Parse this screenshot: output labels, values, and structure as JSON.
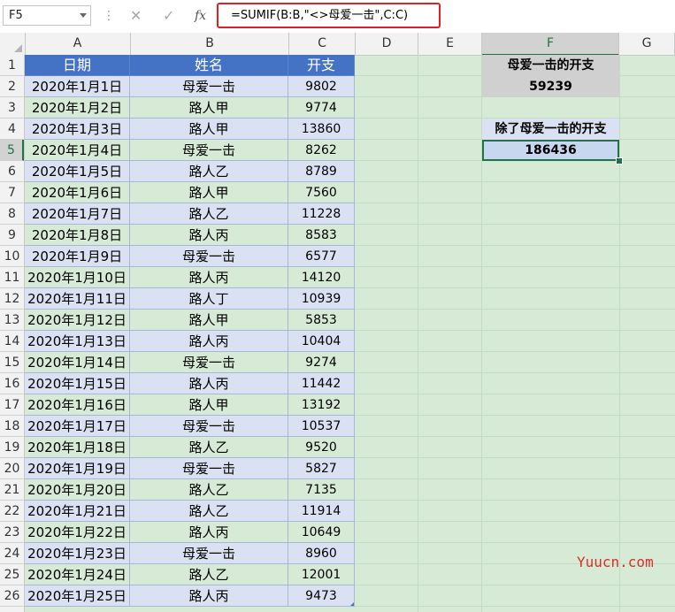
{
  "formula_bar": {
    "name_box": "F5",
    "cancel_icon": "✕",
    "enter_icon": "✓",
    "fx_label": "fx",
    "formula": "=SUMIF(B:B,\"<>母爱一击\",C:C)"
  },
  "columns": [
    "A",
    "B",
    "C",
    "D",
    "E",
    "F",
    "G"
  ],
  "selected_column": "F",
  "rows": [
    "1",
    "2",
    "3",
    "4",
    "5",
    "6",
    "7",
    "8",
    "9",
    "10",
    "11",
    "12",
    "13",
    "14",
    "15",
    "16",
    "17",
    "18",
    "19",
    "20",
    "21",
    "22",
    "23",
    "24",
    "25",
    "26"
  ],
  "selected_row": "5",
  "table": {
    "headers": [
      "日期",
      "姓名",
      "开支"
    ],
    "records": [
      [
        "2020年1月1日",
        "母爱一击",
        "9802"
      ],
      [
        "2020年1月2日",
        "路人甲",
        "9774"
      ],
      [
        "2020年1月3日",
        "路人甲",
        "13860"
      ],
      [
        "2020年1月4日",
        "母爱一击",
        "8262"
      ],
      [
        "2020年1月5日",
        "路人乙",
        "8789"
      ],
      [
        "2020年1月6日",
        "路人甲",
        "7560"
      ],
      [
        "2020年1月7日",
        "路人乙",
        "11228"
      ],
      [
        "2020年1月8日",
        "路人丙",
        "8583"
      ],
      [
        "2020年1月9日",
        "母爱一击",
        "6577"
      ],
      [
        "2020年1月10日",
        "路人丙",
        "14120"
      ],
      [
        "2020年1月11日",
        "路人丁",
        "10939"
      ],
      [
        "2020年1月12日",
        "路人甲",
        "5853"
      ],
      [
        "2020年1月13日",
        "路人丙",
        "10404"
      ],
      [
        "2020年1月14日",
        "母爱一击",
        "9274"
      ],
      [
        "2020年1月15日",
        "路人丙",
        "11442"
      ],
      [
        "2020年1月16日",
        "路人甲",
        "13192"
      ],
      [
        "2020年1月17日",
        "母爱一击",
        "10537"
      ],
      [
        "2020年1月18日",
        "路人乙",
        "9520"
      ],
      [
        "2020年1月19日",
        "母爱一击",
        "5827"
      ],
      [
        "2020年1月20日",
        "路人乙",
        "7135"
      ],
      [
        "2020年1月21日",
        "路人乙",
        "11914"
      ],
      [
        "2020年1月22日",
        "路人丙",
        "10649"
      ],
      [
        "2020年1月23日",
        "母爱一击",
        "8960"
      ],
      [
        "2020年1月24日",
        "路人乙",
        "12001"
      ],
      [
        "2020年1月25日",
        "路人丙",
        "9473"
      ]
    ]
  },
  "summary": {
    "f1_label": "母爱一击的开支",
    "f2_value": "59239",
    "f4_label": "除了母爱一击的开支",
    "f5_value": "186436"
  },
  "watermark": "Yuucn.com",
  "colors": {
    "header_blue": "#4472c4",
    "row_blue": "#d9e1f2",
    "sheet_green": "#d6ead6",
    "highlight_red": "#e02020",
    "selection_green": "#217346"
  }
}
